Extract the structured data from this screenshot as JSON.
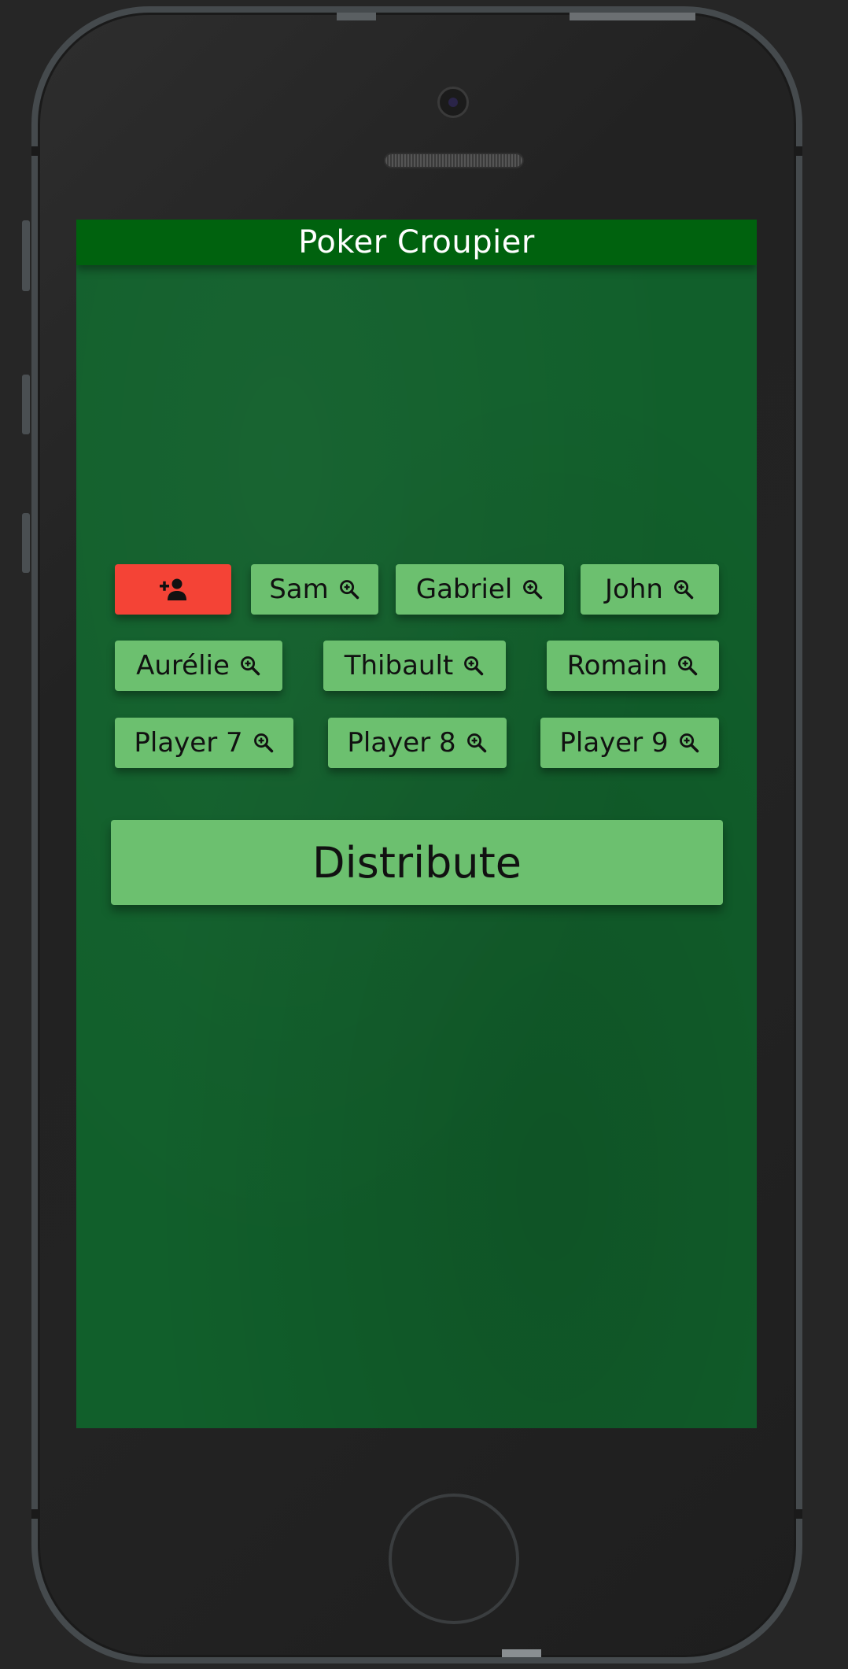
{
  "app": {
    "title": "Poker Croupier"
  },
  "players": [
    {
      "name": "Sam"
    },
    {
      "name": "Gabriel"
    },
    {
      "name": "John"
    },
    {
      "name": "Aurélie"
    },
    {
      "name": "Thibault"
    },
    {
      "name": "Romain"
    },
    {
      "name": "Player 7"
    },
    {
      "name": "Player 8"
    },
    {
      "name": "Player 9"
    }
  ],
  "add_player": {
    "icon": "person-add-icon"
  },
  "player_icon": "zoom-in-icon",
  "actions": {
    "distribute_label": "Distribute"
  },
  "colors": {
    "app_bar": "#00620e",
    "table_felt": "#115f2b",
    "chip": "#6cc06f",
    "add_button": "#f44336"
  }
}
